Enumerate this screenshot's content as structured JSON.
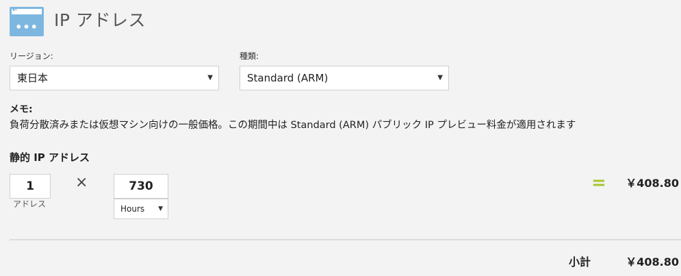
{
  "header": {
    "icon": "public-ip-window-icon",
    "title": "IP アドレス"
  },
  "region": {
    "label": "リージョン:",
    "selected": "東日本"
  },
  "tier": {
    "label": "種類:",
    "selected": "Standard (ARM)"
  },
  "note": {
    "title": "メモ:",
    "text": "負荷分散済みまたは仮想マシン向けの一般価格。この期間中は Standard (ARM) パブリック IP プレビュー料金が適用されます"
  },
  "static_ip": {
    "title": "静的 IP アドレス",
    "quantity": "1",
    "quantity_unit": "アドレス",
    "multiply_symbol": "×",
    "hours_value": "730",
    "hours_unit_selected": "Hours",
    "equals_symbol": "=",
    "cost": "￥408.80"
  },
  "subtotal": {
    "label": "小計",
    "value": "￥408.80"
  },
  "colors": {
    "accent_equals": "#a6c62e",
    "icon_blue": "#7db7e0",
    "background": "#f3f3f3"
  }
}
